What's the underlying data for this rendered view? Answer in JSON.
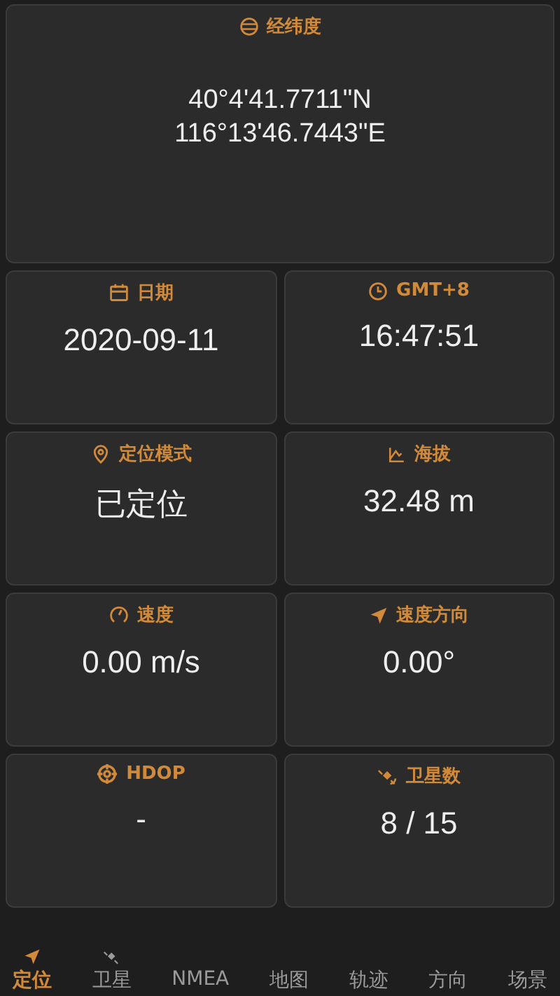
{
  "coordinates": {
    "label": "经纬度",
    "values": [
      "40°4'41.7711\"N",
      "116°13'46.7443\"E"
    ]
  },
  "cards": [
    {
      "label": "日期",
      "value": "2020-09-11"
    },
    {
      "label": "GMT+8",
      "value": "16:47:51"
    },
    {
      "label": "定位模式",
      "value": "已定位"
    },
    {
      "label": "海拔",
      "value": "32.48 m"
    },
    {
      "label": "速度",
      "value": "0.00 m/s"
    },
    {
      "label": "速度方向",
      "value": "0.00°"
    },
    {
      "label": "HDOP",
      "value": "-"
    },
    {
      "label": "卫星数",
      "value": "8 / 15"
    }
  ],
  "nav": [
    {
      "label": "定位",
      "selected": true
    },
    {
      "label": "卫星",
      "selected": false
    },
    {
      "label": "NMEA",
      "selected": false
    },
    {
      "label": "地图",
      "selected": false
    },
    {
      "label": "轨迹",
      "selected": false
    },
    {
      "label": "方向",
      "selected": false
    },
    {
      "label": "场景",
      "selected": false
    }
  ]
}
